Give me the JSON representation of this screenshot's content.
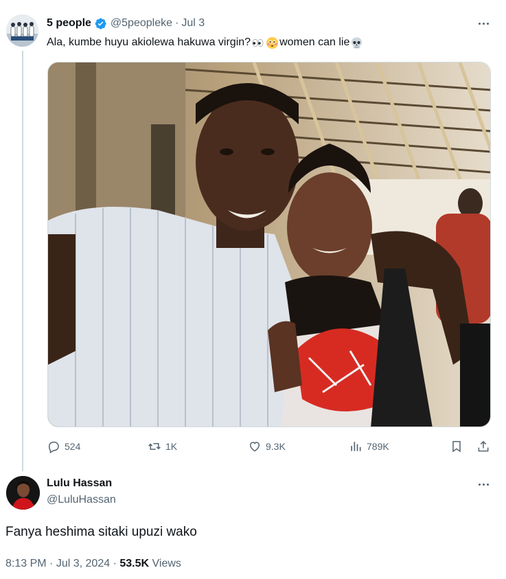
{
  "tweet": {
    "author_name": "5 people",
    "author_handle": "@5peopleke",
    "separator": "·",
    "date": "Jul 3",
    "text_part1": "Ala, kumbe huyu akiolewa hakuwa virgin?",
    "text_part2": "women can lie",
    "emojis": [
      "eyes-emoji",
      "flushed-face-emoji",
      "skull-emoji"
    ],
    "photo_alt": "Selfie of a man in a white striped shirt with his arm around a woman wearing a black scarf and red and white top"
  },
  "actions": {
    "replies": "524",
    "retweets": "1K",
    "likes": "9.3K",
    "views": "789K"
  },
  "reply": {
    "author_name": "Lulu Hassan",
    "author_handle": "@LuluHassan",
    "text": "Fanya heshima sitaki upuzi wako",
    "time": "8:13 PM",
    "separator": "·",
    "date": "Jul 3, 2024",
    "separator2": "·",
    "views_count": "53.5K",
    "views_label": "Views"
  },
  "colors": {
    "text_primary": "#0f1419",
    "text_secondary": "#536471",
    "verified": "#1d9bf0",
    "thread_line": "#cfd9de"
  }
}
